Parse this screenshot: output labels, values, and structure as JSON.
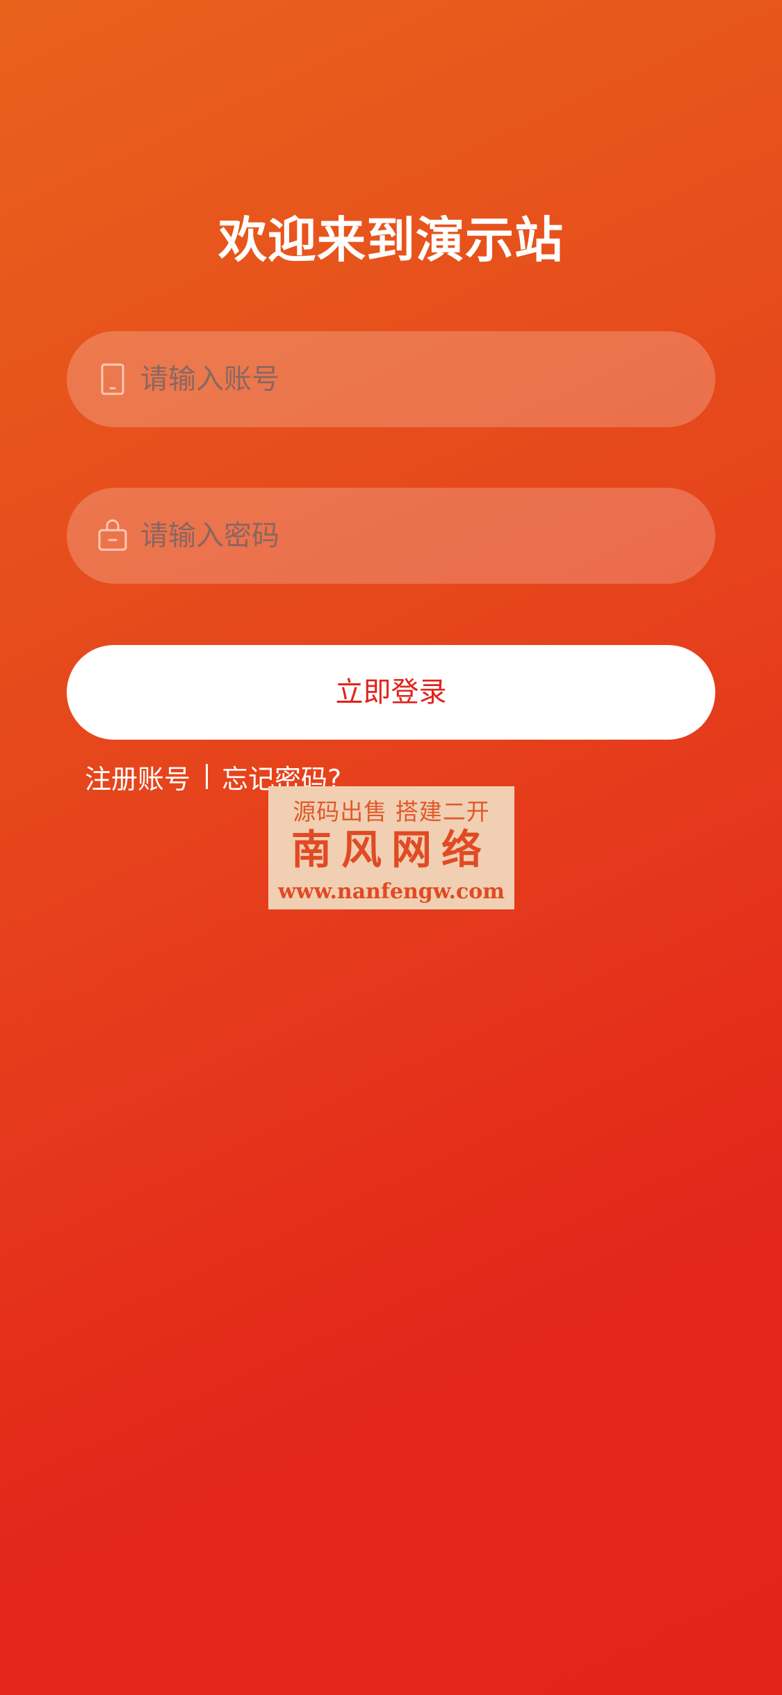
{
  "header": {
    "title": "欢迎来到演示站"
  },
  "form": {
    "account": {
      "icon": "phone-icon",
      "placeholder": "请输入账号",
      "value": ""
    },
    "password": {
      "icon": "lock-icon",
      "placeholder": "请输入密码",
      "value": ""
    },
    "login_label": "立即登录"
  },
  "links": {
    "register": "注册账号",
    "forgot": "忘记密码?"
  },
  "watermark": {
    "line1": "源码出售  搭建二开",
    "line2": "南风网络",
    "line3": "www.nanfengw.com"
  },
  "colors": {
    "gradient_start": "#e8621c",
    "gradient_end": "#e3241a",
    "button_bg": "#ffffff",
    "button_text": "#e0231a",
    "watermark_bg": "#f1cfb2"
  }
}
